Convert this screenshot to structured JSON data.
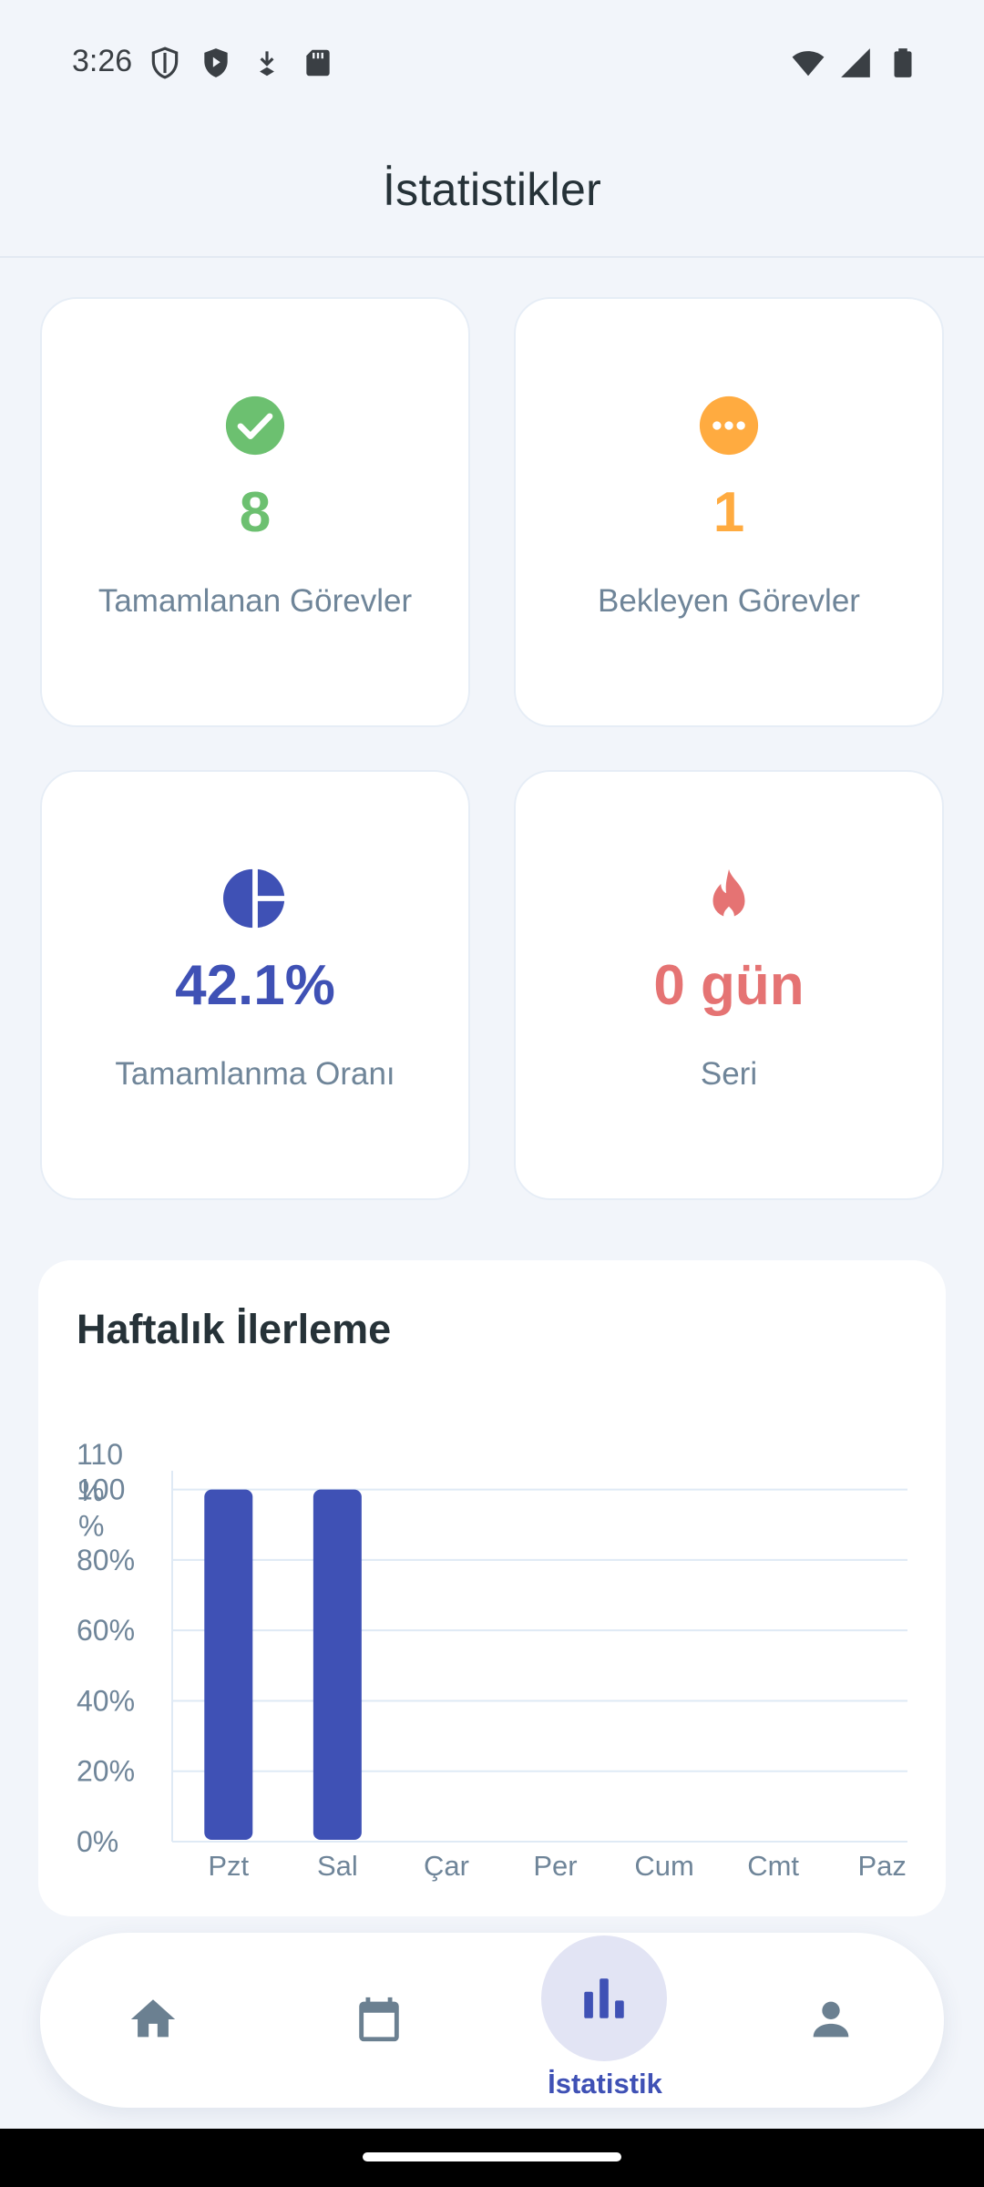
{
  "status_bar": {
    "time": "3:26",
    "left_icons": [
      "vpn-shield-outline-icon",
      "shield-play-icon",
      "download-arrow-icon",
      "sd-card-icon"
    ],
    "right_icons": [
      "wifi-icon",
      "signal-icon",
      "battery-icon"
    ]
  },
  "header": {
    "title": "İstatistikler"
  },
  "stats": {
    "completed": {
      "value": "8",
      "label": "Tamamlanan Görevler",
      "color": "#6cc070",
      "icon": "check-circle-icon"
    },
    "pending": {
      "value": "1",
      "label": "Bekleyen Görevler",
      "color": "#ffab40",
      "icon": "more-horiz-circle-icon"
    },
    "rate": {
      "value": "42.1%",
      "label": "Tamamlanma Oranı",
      "color": "#3f51b5",
      "icon": "pie-chart-icon"
    },
    "streak": {
      "value": "0 gün",
      "label": "Seri",
      "color": "#e57373",
      "icon": "fire-icon"
    }
  },
  "chart": {
    "title": "Haftalık İlerleme",
    "bar_color": "#3f51b5"
  },
  "chart_data": {
    "type": "bar",
    "title": "Haftalık İlerleme",
    "categories": [
      "Pzt",
      "Sal",
      "Çar",
      "Per",
      "Cum",
      "Cmt",
      "Paz"
    ],
    "values": [
      100,
      100,
      0,
      0,
      0,
      0,
      0
    ],
    "ylim": [
      0,
      110
    ],
    "y_ticks": [
      {
        "value": 0,
        "label": "0%"
      },
      {
        "value": 20,
        "label": "20%"
      },
      {
        "value": 40,
        "label": "40%"
      },
      {
        "value": 60,
        "label": "60%"
      },
      {
        "value": 80,
        "label": "80%"
      },
      {
        "value": 100,
        "label": "100 %"
      },
      {
        "value": 110,
        "label": "110 %"
      }
    ],
    "grid": true,
    "xlabel": "",
    "ylabel": ""
  },
  "bottom_nav": {
    "items": [
      {
        "icon": "home-icon",
        "label": ""
      },
      {
        "icon": "calendar-icon",
        "label": ""
      },
      {
        "icon": "bar-chart-icon",
        "label": "İstatistik",
        "active": true
      },
      {
        "icon": "person-icon",
        "label": ""
      }
    ],
    "active_color": "#3f51b5",
    "inactive_color": "#6b8091"
  }
}
